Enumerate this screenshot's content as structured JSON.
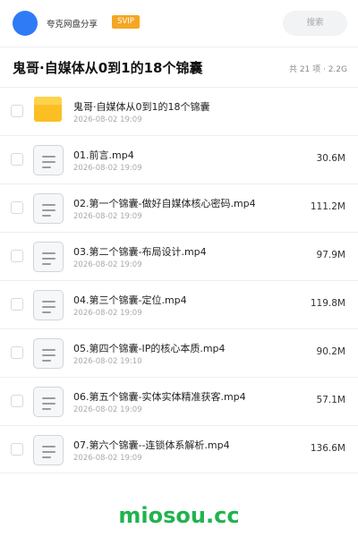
{
  "header": {
    "user_name": "夸克网盘分享",
    "badge": "SVIP",
    "search_label": "搜索"
  },
  "folder": {
    "title": "鬼哥·自媒体从0到1的18个锦囊",
    "meta": "共 21 项 · 2.2G"
  },
  "files": [
    {
      "type": "folder",
      "name": "鬼哥·自媒体从0到1的18个锦囊",
      "date": "2026-08-02 19:09",
      "size": ""
    },
    {
      "type": "video",
      "name": "01.前言.mp4",
      "date": "2026-08-02 19:09",
      "size": "30.6M"
    },
    {
      "type": "video",
      "name": "02.第一个锦囊-做好自媒体核心密码.mp4",
      "date": "2026-08-02 19:09",
      "size": "111.2M"
    },
    {
      "type": "video",
      "name": "03.第二个锦囊-布局设计.mp4",
      "date": "2026-08-02 19:09",
      "size": "97.9M"
    },
    {
      "type": "video",
      "name": "04.第三个锦囊-定位.mp4",
      "date": "2026-08-02 19:09",
      "size": "119.8M"
    },
    {
      "type": "video",
      "name": "05.第四个锦囊-IP的核心本质.mp4",
      "date": "2026-08-02 19:10",
      "size": "90.2M"
    },
    {
      "type": "video",
      "name": "06.第五个锦囊-实体实体精准获客.mp4",
      "date": "2026-08-02 19:09",
      "size": "57.1M"
    },
    {
      "type": "video",
      "name": "07.第六个锦囊--连锁体系解析.mp4",
      "date": "2026-08-02 19:09",
      "size": "136.6M"
    }
  ],
  "watermark": "miosou.cc",
  "colors": {
    "avatar": "#2f7bf6",
    "badge": "#f5a623",
    "folder_icon": "#fbbf24",
    "watermark": "#21b34f"
  }
}
